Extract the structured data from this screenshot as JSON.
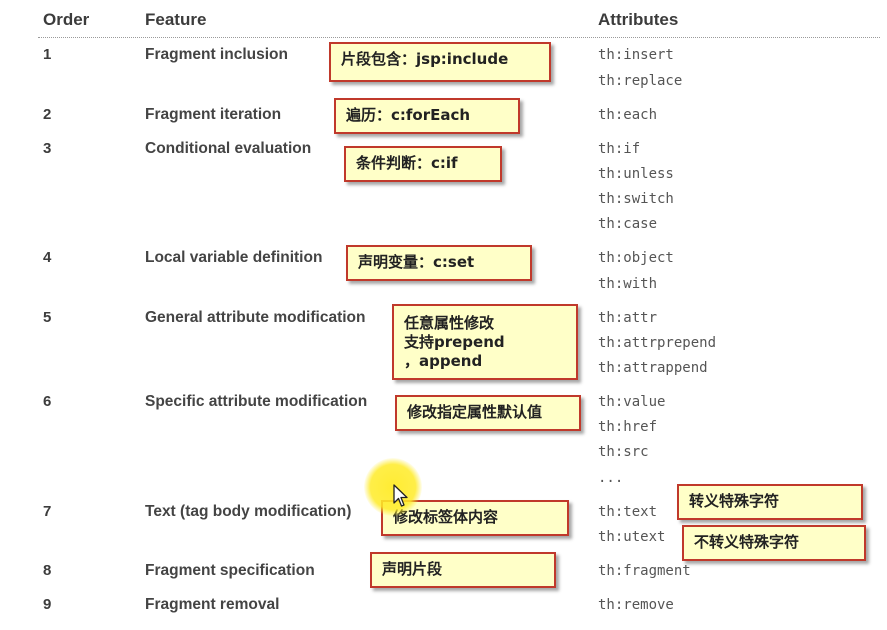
{
  "header": {
    "order": "Order",
    "feature": "Feature",
    "attributes": "Attributes"
  },
  "rows": [
    {
      "order": "1",
      "feature": "Fragment inclusion",
      "attrs": [
        "th:insert",
        "th:replace"
      ]
    },
    {
      "order": "2",
      "feature": "Fragment iteration",
      "attrs": [
        "th:each"
      ]
    },
    {
      "order": "3",
      "feature": "Conditional evaluation",
      "attrs": [
        "th:if",
        "th:unless",
        "th:switch",
        "th:case"
      ]
    },
    {
      "order": "4",
      "feature": "Local variable definition",
      "attrs": [
        "th:object",
        "th:with"
      ]
    },
    {
      "order": "5",
      "feature": "General attribute modification",
      "attrs": [
        "th:attr",
        "th:attrprepend",
        "th:attrappend"
      ]
    },
    {
      "order": "6",
      "feature": "Specific attribute modification",
      "attrs": [
        "th:value",
        "th:href",
        "th:src",
        "..."
      ]
    },
    {
      "order": "7",
      "feature": "Text (tag body modification)",
      "attrs": [
        "th:text",
        "th:utext"
      ]
    },
    {
      "order": "8",
      "feature": "Fragment specification",
      "attrs": [
        "th:fragment"
      ]
    },
    {
      "order": "9",
      "feature": "Fragment removal",
      "attrs": [
        "th:remove"
      ]
    }
  ],
  "notes": {
    "n1": "片段包含：jsp:include",
    "n2": "遍历：c:forEach",
    "n3": "条件判断：c:if",
    "n4": "声明变量：c:set",
    "n5": [
      "任意属性修改",
      "支持prepend",
      "，append"
    ],
    "n6": "修改指定属性默认值",
    "n7": "修改标签体内容",
    "n7a": "转义特殊字符",
    "n7b": "不转义特殊字符",
    "n8": "声明片段"
  }
}
